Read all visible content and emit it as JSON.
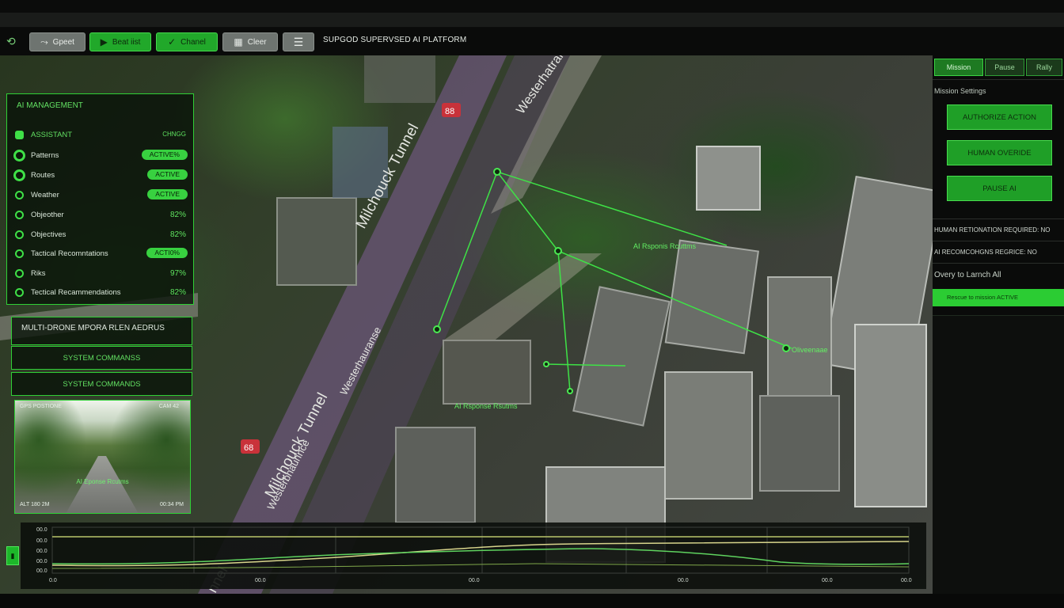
{
  "app": {
    "title": "SUPGOD SUPERVSED AI PLATFORM",
    "accent": "#2fd035"
  },
  "toolbar": {
    "buttons": [
      {
        "label": "Gpeet",
        "icon": "route-icon",
        "style": "gray"
      },
      {
        "label": "Beat iist",
        "icon": "play-icon",
        "style": "green"
      },
      {
        "label": "Chanel",
        "icon": "leaf-icon",
        "style": "green"
      },
      {
        "label": "Cleer",
        "icon": "trash-icon",
        "style": "gray"
      }
    ],
    "menu_icon": "hamburger-icon"
  },
  "map": {
    "labels": {
      "tunnel_1": "Milchouck Tunnel",
      "tunnel_2": "Milchouck Tunnel",
      "tunnel_3": "nnel",
      "street_1": "Westerhatran",
      "street_2": "Westerhauranse",
      "street_3": "Westerbhaunnce",
      "sign_1": "88",
      "sign_2": "68",
      "ai_1": "AI Rsponis Rcuttms",
      "ai_2": "AI Rsponse Rsutms",
      "ai_3": "Oliveenaae"
    }
  },
  "ai_management": {
    "title": "AI MANAGEMENT",
    "header": {
      "label": "ASSISTANT",
      "value": "CHNGG"
    },
    "rows": [
      {
        "label": "Patterns",
        "badge": "ACTIVE%"
      },
      {
        "label": "Routes",
        "badge": "ACTIVE"
      },
      {
        "label": "Weather",
        "badge": "ACTIVE"
      },
      {
        "label": "Objeother",
        "value": "82%"
      },
      {
        "label": "Objectives",
        "value": "82%"
      },
      {
        "label": "Tactical Recomntations",
        "badge": "ACTI0%"
      },
      {
        "label": "Riks",
        "value": "97%"
      },
      {
        "label": "Tectical Recammendations",
        "value": "82%"
      }
    ]
  },
  "drone_panel": {
    "title": "MULTI-DRONE MPORA RLEN AEDRUS",
    "commands": [
      "SYSTEM COMMANSS",
      "SYSTEM COMMANDS"
    ]
  },
  "camera": {
    "top_left": "GPS POSTIONE",
    "top_right": "CAM 42",
    "bottom_left": "ALT 180 2M",
    "bottom_right": "00:34 PM",
    "center": "AI Eponse Rcutms"
  },
  "right_panel": {
    "tabs": [
      {
        "label": "Mission",
        "active": true
      },
      {
        "label": "Pause",
        "active": false
      },
      {
        "label": "Rally",
        "active": false
      }
    ],
    "section_title": "Mission Settings",
    "buttons": [
      "AUTHORIZE ACTION",
      "HUMAN OVERIDE",
      "PAUSE AI"
    ],
    "lines": [
      "HUMAN RETIONATION REQUIRED: NO",
      "AI RECOMCOHGNS REGRICE: NO"
    ],
    "launch": "Overy to Larnch All",
    "bar": "Rescue to mission ACTIVE"
  },
  "graph": {
    "y_ticks": [
      "00.0",
      "00.0",
      "00.0",
      "00.0",
      "00.0"
    ],
    "x_ticks": [
      "0.0",
      "00.0",
      "00.0",
      "00.0",
      "00.0",
      "00.0"
    ],
    "series_colors": [
      "#b9c56a",
      "#5fd35f",
      "#d8d58c"
    ]
  }
}
